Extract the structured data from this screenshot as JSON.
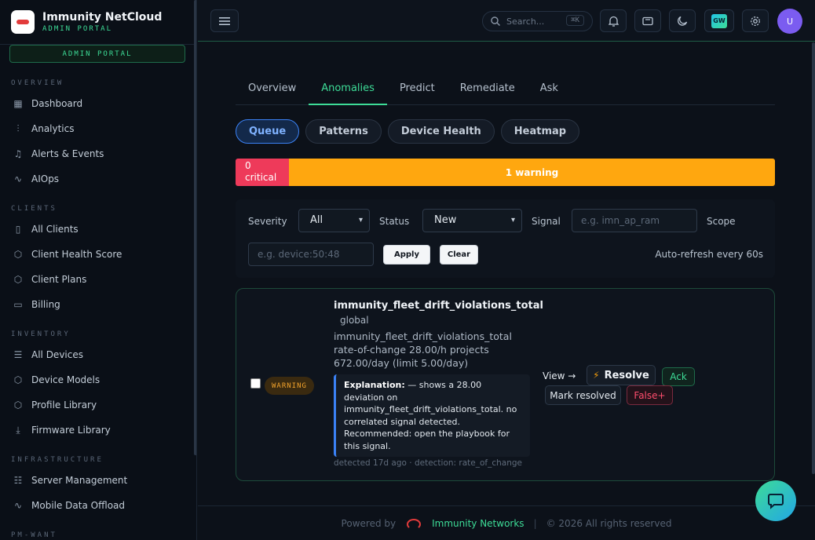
{
  "brand": {
    "title": "Immunity NetCloud",
    "subtitle": "ADMIN PORTAL",
    "pill": "ADMIN PORTAL"
  },
  "sidebar": {
    "sections": [
      {
        "title": "OVERVIEW",
        "items": [
          {
            "label": "Dashboard",
            "icon": "grid-icon"
          },
          {
            "label": "Analytics",
            "icon": "chart-icon"
          },
          {
            "label": "Alerts & Events",
            "icon": "bell-icon"
          },
          {
            "label": "AIOps",
            "icon": "pulse-icon"
          }
        ]
      },
      {
        "title": "CLIENTS",
        "items": [
          {
            "label": "All Clients",
            "icon": "building-icon"
          },
          {
            "label": "Client Health Score",
            "icon": "shield-icon"
          },
          {
            "label": "Client Plans",
            "icon": "shield-icon"
          },
          {
            "label": "Billing",
            "icon": "card-icon"
          }
        ]
      },
      {
        "title": "INVENTORY",
        "items": [
          {
            "label": "All Devices",
            "icon": "stack-icon"
          },
          {
            "label": "Device Models",
            "icon": "shield-icon"
          },
          {
            "label": "Profile Library",
            "icon": "shield-icon"
          },
          {
            "label": "Firmware Library",
            "icon": "download-icon"
          }
        ]
      },
      {
        "title": "INFRASTRUCTURE",
        "items": [
          {
            "label": "Server Management",
            "icon": "server-icon"
          },
          {
            "label": "Mobile Data Offload",
            "icon": "pulse-icon"
          }
        ]
      },
      {
        "title": "PM-WANT",
        "items": []
      }
    ]
  },
  "topbar": {
    "search_placeholder": "Search...",
    "search_kbd": "⌘K",
    "gw_label": "GW",
    "avatar_initial": "U"
  },
  "tabs": [
    {
      "label": "Overview",
      "active": false
    },
    {
      "label": "Anomalies",
      "active": true
    },
    {
      "label": "Predict",
      "active": false
    },
    {
      "label": "Remediate",
      "active": false
    },
    {
      "label": "Ask",
      "active": false
    }
  ],
  "subtabs": [
    {
      "label": "Queue",
      "active": true
    },
    {
      "label": "Patterns",
      "active": false
    },
    {
      "label": "Device Health",
      "active": false
    },
    {
      "label": "Heatmap",
      "active": false
    }
  ],
  "severity_bar": {
    "critical_label": "0 critical",
    "critical_count": 0,
    "warning_label": "1 warning",
    "warning_count": 1,
    "colors": {
      "critical": "#ee3a5a",
      "warning": "#ffa70f"
    }
  },
  "filters": {
    "severity_label": "Severity",
    "severity_value": "All",
    "status_label": "Status",
    "status_value": "New",
    "signal_label": "Signal",
    "signal_placeholder": "e.g. imn_ap_ram",
    "scope_label": "Scope",
    "scope_placeholder": "e.g. device:50:48",
    "apply_label": "Apply",
    "clear_label": "Clear",
    "auto_refresh": "Auto-refresh every 60s"
  },
  "anomaly": {
    "severity_badge": "WARNING",
    "title": "immunity_fleet_drift_violations_total",
    "scope": "global",
    "description": "immunity_fleet_drift_violations_total rate-of-change 28.00/h projects 672.00/day (limit 5.00/day)",
    "explanation_label": "Explanation:",
    "explanation_text": " — shows a 28.00 deviation on immunity_fleet_drift_violations_total. no correlated signal detected. Recommended: open the playbook for this signal.",
    "meta": "detected 17d ago · detection: rate_of_change",
    "view_label": "View →",
    "resolve_label": "Resolve",
    "ack_label": "Ack",
    "mark_resolved_label": "Mark resolved",
    "false_positive_label": "False+"
  },
  "footer": {
    "powered_by": "Powered by",
    "brand": "Immunity Networks",
    "separator": "|",
    "copyright": "© 2026 All rights reserved"
  },
  "accent_color": "#3ddc97"
}
